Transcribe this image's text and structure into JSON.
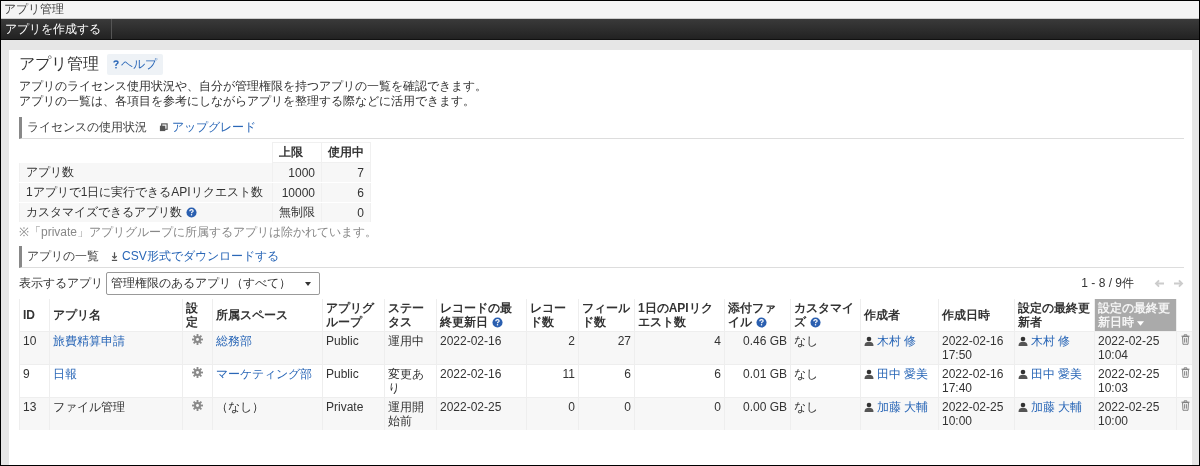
{
  "window": {
    "title": "アプリ管理"
  },
  "toolbar": {
    "create_button": "アプリを作成する"
  },
  "page": {
    "heading": "アプリ管理",
    "help_link": "ヘルプ",
    "description": [
      "アプリのライセンス使用状況や、自分が管理権限を持つアプリの一覧を確認できます。",
      "アプリの一覧は、各項目を参考にしながらアプリを整理する際などに活用できます。"
    ]
  },
  "license": {
    "heading": "ライセンスの使用状況",
    "upgrade_link": "アップグレード",
    "columns": [
      "上限",
      "使用中"
    ],
    "rows": [
      {
        "label": "アプリ数",
        "help": false,
        "limit": "1000",
        "used": "7"
      },
      {
        "label": "1アプリで1日に実行できるAPIリクエスト数",
        "help": false,
        "limit": "10000",
        "used": "6"
      },
      {
        "label": "カスタマイズできるアプリ数",
        "help": true,
        "limit": "無制限",
        "used": "0"
      }
    ],
    "note": "※「private」アプリグループに所属するアプリは除かれています。"
  },
  "app_list": {
    "heading": "アプリの一覧",
    "csv_link": "CSV形式でダウンロードする",
    "filter_label": "表示するアプリ",
    "filter_value": "管理権限のあるアプリ（すべて）",
    "pagination": "1 - 8 / 9件",
    "columns": [
      {
        "label": "ID",
        "help": false,
        "selected": false
      },
      {
        "label": "アプリ名",
        "help": false,
        "selected": false
      },
      {
        "label": "設定",
        "help": false,
        "selected": false
      },
      {
        "label": "所属スペース",
        "help": false,
        "selected": false
      },
      {
        "label": "アプリグループ",
        "help": false,
        "selected": false
      },
      {
        "label": "ステータス",
        "help": false,
        "selected": false
      },
      {
        "label": "レコードの最終更新日",
        "help": true,
        "selected": false
      },
      {
        "label": "レコード数",
        "help": false,
        "selected": false
      },
      {
        "label": "フィールド数",
        "help": false,
        "selected": false
      },
      {
        "label": "1日のAPIリクエスト数",
        "help": false,
        "selected": false
      },
      {
        "label": "添付ファイル",
        "help": true,
        "selected": false
      },
      {
        "label": "カスタマイズ",
        "help": true,
        "selected": false
      },
      {
        "label": "作成者",
        "help": false,
        "selected": false
      },
      {
        "label": "作成日時",
        "help": false,
        "selected": false
      },
      {
        "label": "設定の最終更新者",
        "help": false,
        "selected": false
      },
      {
        "label": "設定の最終更新日時",
        "help": false,
        "selected": true
      }
    ],
    "rows": [
      {
        "id": "10",
        "name": "旅費精算申請",
        "name_link": true,
        "space": "総務部",
        "space_link": true,
        "group": "Public",
        "status": "運用中",
        "record_updated": "2022-02-16",
        "records": "2",
        "fields": "27",
        "api_requests": "4",
        "attachments": "0.46 GB",
        "customize": "なし",
        "creator": "木村 修",
        "created": "2022-02-16 17:50",
        "updater": "木村 修",
        "updated": "2022-02-25 10:04"
      },
      {
        "id": "9",
        "name": "日報",
        "name_link": true,
        "space": "マーケティング部",
        "space_link": true,
        "group": "Public",
        "status": "変更あり",
        "record_updated": "2022-02-16",
        "records": "11",
        "fields": "6",
        "api_requests": "6",
        "attachments": "0.01 GB",
        "customize": "なし",
        "creator": "田中 愛美",
        "created": "2022-02-16 17:40",
        "updater": "田中 愛美",
        "updated": "2022-02-25 10:03"
      },
      {
        "id": "13",
        "name": "ファイル管理",
        "name_link": false,
        "space": "（なし）",
        "space_link": false,
        "group": "Private",
        "status": "運用開始前",
        "record_updated": "2022-02-25",
        "records": "0",
        "fields": "0",
        "api_requests": "0",
        "attachments": "0.00 GB",
        "customize": "なし",
        "creator": "加藤 大輔",
        "created": "2022-02-25 10:00",
        "updater": "加藤 大輔",
        "updated": "2022-02-25 10:00"
      }
    ]
  }
}
